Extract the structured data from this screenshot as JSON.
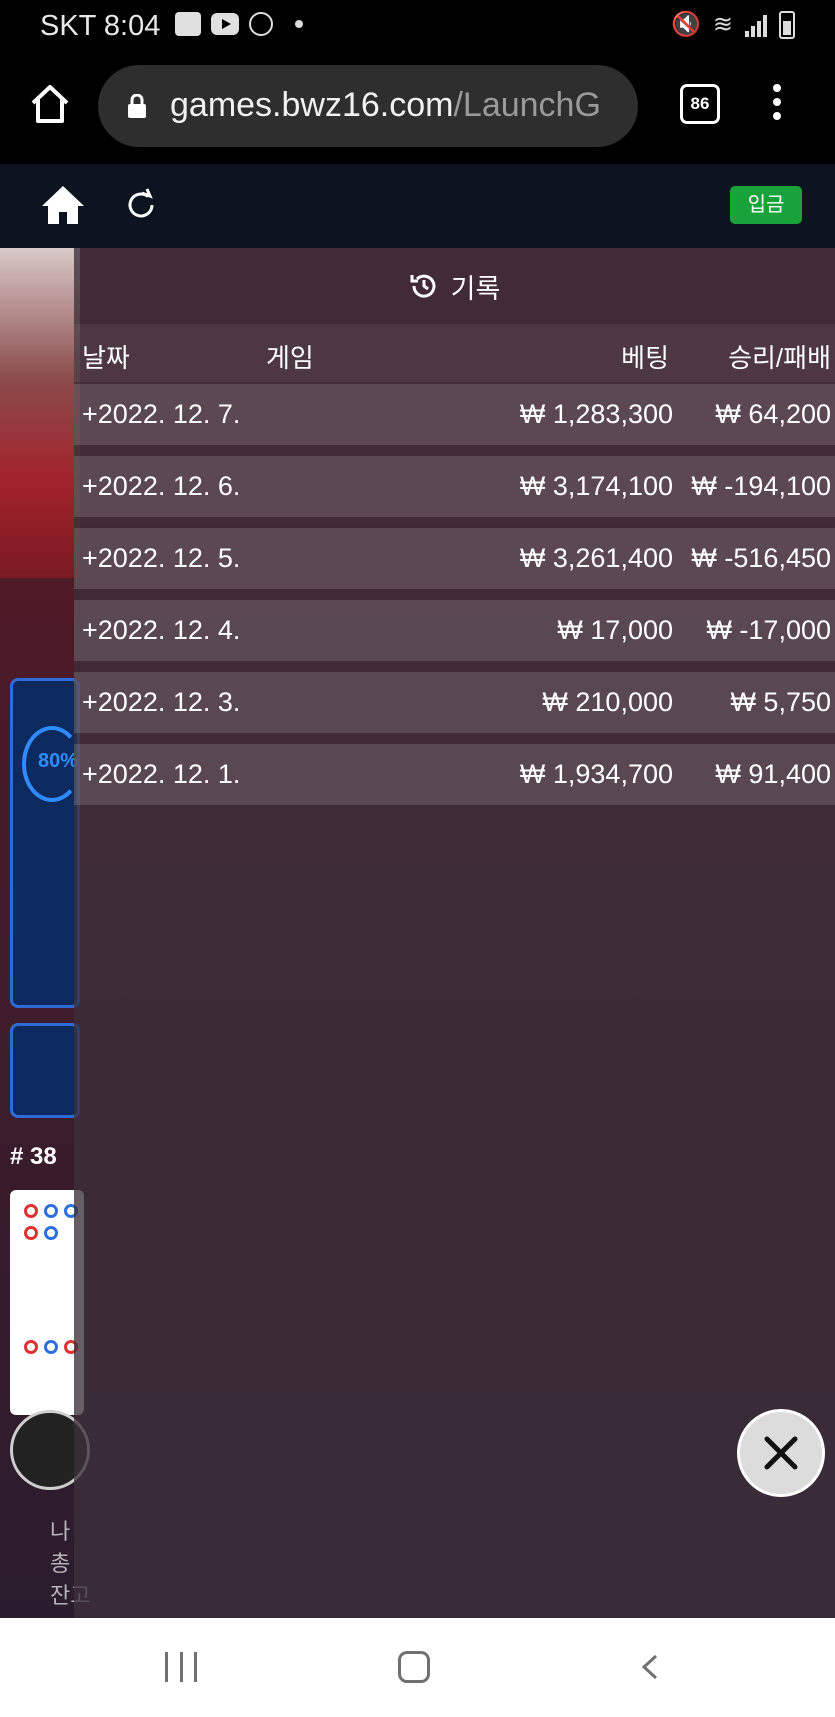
{
  "status_bar": {
    "time": "SKT 8:04"
  },
  "browser": {
    "url_domain": "games.bwz16.com",
    "url_path": "/LaunchG",
    "tab_count": "86"
  },
  "toolbar": {
    "deposit_label": "입금"
  },
  "history": {
    "title": "기록",
    "columns": {
      "date": "날짜",
      "game": "게임",
      "bet": "베팅",
      "result": "승리/패배"
    },
    "rows": [
      {
        "date": "+2022. 12. 7.",
        "bet": "₩ 1,283,300",
        "result": "₩ 64,200"
      },
      {
        "date": "+2022. 12. 6.",
        "bet": "₩ 3,174,100",
        "result": "₩ -194,100"
      },
      {
        "date": "+2022. 12. 5.",
        "bet": "₩ 3,261,400",
        "result": "₩ -516,450"
      },
      {
        "date": "+2022. 12. 4.",
        "bet": "₩ 17,000",
        "result": "₩ -17,000"
      },
      {
        "date": "+2022. 12. 3.",
        "bet": "₩ 210,000",
        "result": "₩ 5,750"
      },
      {
        "date": "+2022. 12. 1.",
        "bet": "₩ 1,934,700",
        "result": "₩ 91,400"
      }
    ]
  },
  "background": {
    "percent": "80%",
    "round": "# 38",
    "footer_lines": [
      "나",
      "총",
      "잔고"
    ]
  },
  "colors": {
    "deposit": "#19a23a",
    "accent_blue": "#2f8cff"
  }
}
